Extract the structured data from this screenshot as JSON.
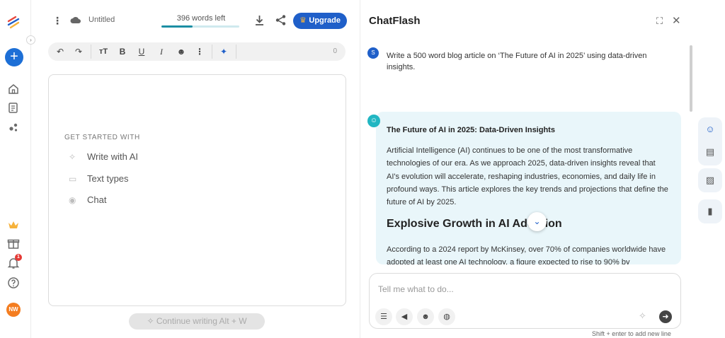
{
  "editor": {
    "doc_title": "Untitled",
    "words_left": "396 words left",
    "words_progress": 0.4,
    "upgrade_label": "Upgrade",
    "toolbar_count": "0",
    "get_started_label": "GET STARTED WITH",
    "get_started_items": [
      "Write with AI",
      "Text types",
      "Chat"
    ],
    "continue_label": "Continue writing Alt + W"
  },
  "rail": {
    "notification_count": "1",
    "avatar_initials": "NW"
  },
  "chat": {
    "title": "ChatFlash",
    "user_avatar": "S",
    "user_message": "Write a 500 word blog article on ‘The Future of AI in 2025’ using data-driven insights.",
    "response_title": "The Future of AI in 2025: Data-Driven Insights",
    "response_p1": "Artificial Intelligence (AI) continues to be one of the most transformative technologies of our era. As we approach 2025, data-driven insights reveal that AI's evolution will accelerate, reshaping industries, economies, and daily life in profound ways. This article explores the key trends and projections that define the future of AI by 2025.",
    "response_h2": "Explosive Growth in AI Adoption",
    "response_p2": "According to a 2024 report by McKinsey, over 70% of companies worldwide have adopted at least one AI technology, a figure expected to rise to 90% by",
    "input_placeholder": "Tell me what to do...",
    "hint": "Shift + enter to add new line"
  },
  "colors": {
    "brand_blue": "#1f5fc9",
    "teal": "#21b6c2",
    "card_bg": "#e9f6fa",
    "crown": "#f6b23b"
  }
}
